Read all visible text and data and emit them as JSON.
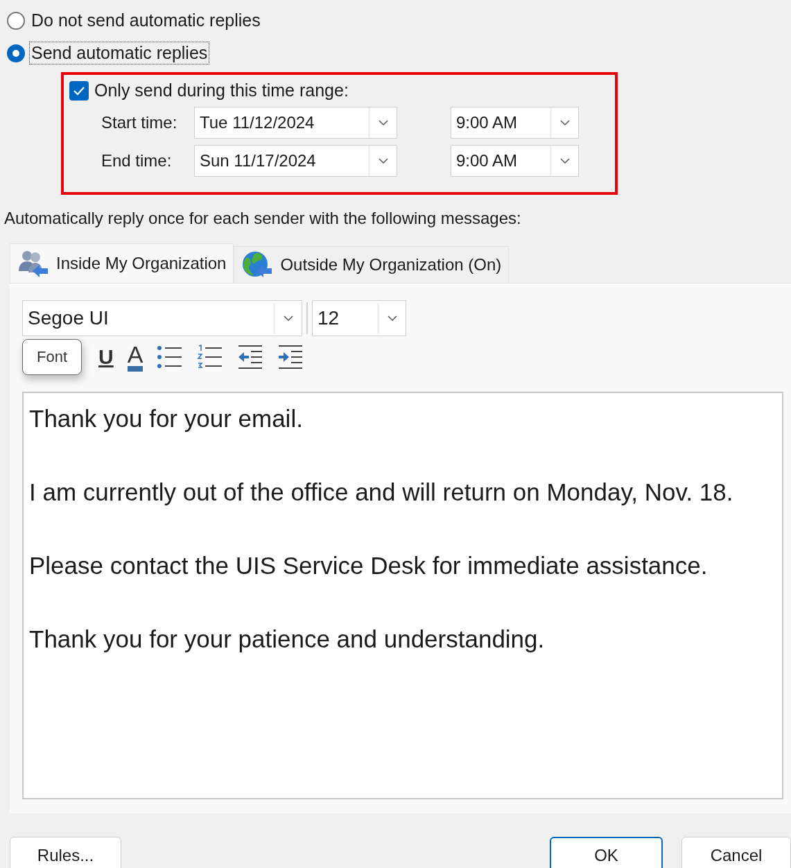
{
  "reply_mode": [
    {
      "label": "Do not send automatic replies",
      "selected": false,
      "focused": false
    },
    {
      "label": "Send automatic replies",
      "selected": true,
      "focused": true
    }
  ],
  "time_range": {
    "label": "Only send during this time range:",
    "checked": true,
    "rows": [
      {
        "label": "Start time:",
        "date": "Tue 11/12/2024",
        "time": "9:00 AM"
      },
      {
        "label": "End time:",
        "date": "Sun 11/17/2024",
        "time": "9:00 AM"
      }
    ]
  },
  "instruction": "Automatically reply once for each sender with the following messages:",
  "tabs": [
    {
      "label": "Inside My Organization",
      "kind": "people",
      "selected": true
    },
    {
      "label": "Outside My Organization (On)",
      "kind": "globe",
      "selected": false
    }
  ],
  "format": {
    "font": "Segoe UI",
    "size": "12",
    "tooltip": "Font",
    "tools": [
      {
        "kind": "underline",
        "glyph": "U"
      },
      {
        "kind": "font-color",
        "glyph": "A"
      },
      {
        "kind": "bullets"
      },
      {
        "kind": "numbering"
      },
      {
        "kind": "outdent"
      },
      {
        "kind": "indent"
      }
    ]
  },
  "message": [
    "Thank you for your email.",
    "I am currently out of the office and will return on Monday, Nov. 18.",
    "Please contact the UIS Service Desk for immediate assistance.",
    "Thank you for your patience and understanding."
  ],
  "buttons": [
    {
      "label": "Rules...",
      "focused": false
    },
    {
      "label": "OK",
      "focused": true
    },
    {
      "label": "Cancel",
      "focused": false
    }
  ]
}
